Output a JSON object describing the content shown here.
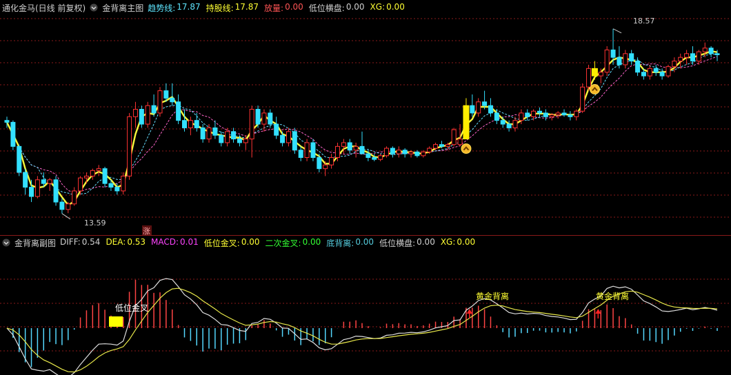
{
  "main_header": {
    "instrument": "通化金马(日线 前复权)",
    "indicator": "金背离主图",
    "items": [
      {
        "key": "趋势线:",
        "val": "17.87",
        "color": "#5ee6ff"
      },
      {
        "key": "持股线:",
        "val": "17.87",
        "color": "#ffff33"
      },
      {
        "key": "放量:",
        "val": "0.00",
        "color": "#ff5555"
      },
      {
        "key": "低位横盘:",
        "val": "0.00",
        "color": "#d0d0d0"
      },
      {
        "key": "XG:",
        "val": "0.00",
        "color": "#ffff33"
      }
    ]
  },
  "sub_header": {
    "indicator": "金背离副图",
    "items": [
      {
        "key": "DIFF:",
        "val": "0.54",
        "color": "#d0d0d0"
      },
      {
        "key": "DEA:",
        "val": "0.53",
        "color": "#ffff33"
      },
      {
        "key": "MACD:",
        "val": "0.01",
        "color": "#ff44ff"
      },
      {
        "key": "低位金叉:",
        "val": "0.00",
        "color": "#ffff33"
      },
      {
        "key": "二次金叉:",
        "val": "0.00",
        "color": "#33ff33"
      },
      {
        "key": "底背离:",
        "val": "0.00",
        "color": "#55ccdd"
      },
      {
        "key": "低位横盘:",
        "val": "0.00",
        "color": "#d0d0d0"
      },
      {
        "key": "XG:",
        "val": "0.00",
        "color": "#ffff33"
      }
    ]
  },
  "annotations": {
    "high_label": "18.57",
    "low_label": "13.59",
    "limit_up_badge": "涨",
    "low_cross_label": "低位金叉",
    "golden_divergence_1": "黄金背离",
    "golden_divergence_2": "黄金背离"
  },
  "colors": {
    "up": "#ff3333",
    "down": "#33e0ff",
    "grid": "#8b1a1a",
    "trend": "#ffff33",
    "diff": "#e0e0e0",
    "dea": "#e8e84a",
    "macd_pos": "#ff4444",
    "macd_neg": "#55d8ff"
  },
  "chart_data": {
    "type": "candlestick",
    "price_range": [
      13.59,
      18.57
    ],
    "candles": [
      [
        16.1,
        16.2,
        15.9,
        16.05
      ],
      [
        16.05,
        16.1,
        15.3,
        15.4
      ],
      [
        15.4,
        15.45,
        14.6,
        14.7
      ],
      [
        14.7,
        14.8,
        14.1,
        14.3
      ],
      [
        14.3,
        14.5,
        13.9,
        14.05
      ],
      [
        14.05,
        14.6,
        14.0,
        14.5
      ],
      [
        14.5,
        14.7,
        14.3,
        14.4
      ],
      [
        14.4,
        14.55,
        14.2,
        14.5
      ],
      [
        14.5,
        14.6,
        13.8,
        13.9
      ],
      [
        13.9,
        14.0,
        13.59,
        13.7
      ],
      [
        13.7,
        13.9,
        13.6,
        13.85
      ],
      [
        13.85,
        14.3,
        13.8,
        14.2
      ],
      [
        14.2,
        14.6,
        14.1,
        14.55
      ],
      [
        14.55,
        14.7,
        14.4,
        14.6
      ],
      [
        14.6,
        14.8,
        14.5,
        14.75
      ],
      [
        14.75,
        14.9,
        14.6,
        14.8
      ],
      [
        14.8,
        14.85,
        14.3,
        14.4
      ],
      [
        14.4,
        14.5,
        14.2,
        14.3
      ],
      [
        14.3,
        14.4,
        14.1,
        14.2
      ],
      [
        14.2,
        14.7,
        14.1,
        14.6
      ],
      [
        14.6,
        16.3,
        14.5,
        16.2
      ],
      [
        16.2,
        16.6,
        15.9,
        16.4
      ],
      [
        16.4,
        16.5,
        15.9,
        16.0
      ],
      [
        16.0,
        16.6,
        15.9,
        16.5
      ],
      [
        16.5,
        16.8,
        16.2,
        16.3
      ],
      [
        16.3,
        17.0,
        16.2,
        16.9
      ],
      [
        16.9,
        17.1,
        16.6,
        16.7
      ],
      [
        16.7,
        17.1,
        16.5,
        16.6
      ],
      [
        16.6,
        16.8,
        16.0,
        16.1
      ],
      [
        16.1,
        16.4,
        15.8,
        15.9
      ],
      [
        15.9,
        16.2,
        15.7,
        16.1
      ],
      [
        16.1,
        16.3,
        15.8,
        15.9
      ],
      [
        15.9,
        16.0,
        15.5,
        15.6
      ],
      [
        15.6,
        16.0,
        15.5,
        15.9
      ],
      [
        15.9,
        16.1,
        15.6,
        15.7
      ],
      [
        15.7,
        15.8,
        15.4,
        15.5
      ],
      [
        15.5,
        15.9,
        15.4,
        15.8
      ],
      [
        15.8,
        15.9,
        15.5,
        15.6
      ],
      [
        15.6,
        15.7,
        15.4,
        15.5
      ],
      [
        15.5,
        15.7,
        15.3,
        15.6
      ],
      [
        15.6,
        16.5,
        15.1,
        16.4
      ],
      [
        16.4,
        16.5,
        15.9,
        16.0
      ],
      [
        16.0,
        16.4,
        15.8,
        16.3
      ],
      [
        16.3,
        16.4,
        15.9,
        16.0
      ],
      [
        16.0,
        16.2,
        15.6,
        15.7
      ],
      [
        15.7,
        15.8,
        15.4,
        15.5
      ],
      [
        15.5,
        15.9,
        15.4,
        15.8
      ],
      [
        15.8,
        15.9,
        15.2,
        15.3
      ],
      [
        15.3,
        15.4,
        15.0,
        15.1
      ],
      [
        15.1,
        15.6,
        15.0,
        15.5
      ],
      [
        15.5,
        15.6,
        15.0,
        15.1
      ],
      [
        15.1,
        15.2,
        14.7,
        14.8
      ],
      [
        14.8,
        15.0,
        14.6,
        14.9
      ],
      [
        14.9,
        15.2,
        14.8,
        15.1
      ],
      [
        15.1,
        15.5,
        15.0,
        15.4
      ],
      [
        15.4,
        15.6,
        15.2,
        15.5
      ],
      [
        15.5,
        15.6,
        15.2,
        15.3
      ],
      [
        15.3,
        15.5,
        15.1,
        15.4
      ],
      [
        15.4,
        15.8,
        15.2,
        15.2
      ],
      [
        15.2,
        15.3,
        15.0,
        15.1
      ],
      [
        15.1,
        15.2,
        15.0,
        15.05
      ],
      [
        15.05,
        15.2,
        15.0,
        15.15
      ],
      [
        15.15,
        15.4,
        15.1,
        15.35
      ],
      [
        15.35,
        15.4,
        15.1,
        15.2
      ],
      [
        15.2,
        15.4,
        15.1,
        15.3
      ],
      [
        15.3,
        15.35,
        15.1,
        15.2
      ],
      [
        15.2,
        15.3,
        15.1,
        15.25
      ],
      [
        15.25,
        15.3,
        15.1,
        15.15
      ],
      [
        15.15,
        15.3,
        15.1,
        15.25
      ],
      [
        15.25,
        15.4,
        15.2,
        15.35
      ],
      [
        15.35,
        15.5,
        15.3,
        15.45
      ],
      [
        15.45,
        15.55,
        15.35,
        15.4
      ],
      [
        15.4,
        15.5,
        15.3,
        15.45
      ],
      [
        15.45,
        15.9,
        15.4,
        15.85
      ],
      [
        15.45,
        16.0,
        15.4,
        15.6
      ],
      [
        15.6,
        16.7,
        15.6,
        16.5
      ],
      [
        16.5,
        16.8,
        16.2,
        16.3
      ],
      [
        16.3,
        16.7,
        16.2,
        16.6
      ],
      [
        16.6,
        16.9,
        16.4,
        16.5
      ],
      [
        16.5,
        16.7,
        16.2,
        16.3
      ],
      [
        16.3,
        16.4,
        16.0,
        16.1
      ],
      [
        16.1,
        16.2,
        15.9,
        16.0
      ],
      [
        16.0,
        16.1,
        15.8,
        15.9
      ],
      [
        15.9,
        16.2,
        15.8,
        16.1
      ],
      [
        16.1,
        16.4,
        16.0,
        16.3
      ],
      [
        16.3,
        16.4,
        16.1,
        16.2
      ],
      [
        16.2,
        16.4,
        16.1,
        16.35
      ],
      [
        16.35,
        16.45,
        16.2,
        16.3
      ],
      [
        16.3,
        16.4,
        16.1,
        16.2
      ],
      [
        16.2,
        16.3,
        16.1,
        16.25
      ],
      [
        16.25,
        16.35,
        16.15,
        16.3
      ],
      [
        16.3,
        16.4,
        16.2,
        16.25
      ],
      [
        16.25,
        16.35,
        16.1,
        16.2
      ],
      [
        16.2,
        16.4,
        16.1,
        16.35
      ],
      [
        16.35,
        17.1,
        16.3,
        17.0
      ],
      [
        17.0,
        17.6,
        16.9,
        17.5
      ],
      [
        17.5,
        17.7,
        17.2,
        17.3
      ],
      [
        17.3,
        17.5,
        17.1,
        17.4
      ],
      [
        17.4,
        18.1,
        17.3,
        18.0
      ],
      [
        18.0,
        18.57,
        17.6,
        17.8
      ],
      [
        17.8,
        18.1,
        17.5,
        17.6
      ],
      [
        17.6,
        18.0,
        17.5,
        17.9
      ],
      [
        17.9,
        18.0,
        17.6,
        17.7
      ],
      [
        17.7,
        17.8,
        17.3,
        17.4
      ],
      [
        17.4,
        17.5,
        17.2,
        17.3
      ],
      [
        17.3,
        17.6,
        17.2,
        17.5
      ],
      [
        17.5,
        17.6,
        17.3,
        17.4
      ],
      [
        17.4,
        17.5,
        17.2,
        17.3
      ],
      [
        17.3,
        17.6,
        17.25,
        17.55
      ],
      [
        17.55,
        17.8,
        17.4,
        17.7
      ],
      [
        17.7,
        17.9,
        17.5,
        17.8
      ],
      [
        17.8,
        18.0,
        17.6,
        17.9
      ],
      [
        17.9,
        18.1,
        17.6,
        17.7
      ],
      [
        17.7,
        18.0,
        17.6,
        17.95
      ],
      [
        17.95,
        18.2,
        17.8,
        18.05
      ],
      [
        18.05,
        18.1,
        17.8,
        17.9
      ],
      [
        17.9,
        18.0,
        17.7,
        17.87
      ]
    ],
    "xg_markers": [
      75,
      96
    ],
    "low_cross_index": 16,
    "golden_divergence_indices": [
      76,
      97
    ]
  }
}
